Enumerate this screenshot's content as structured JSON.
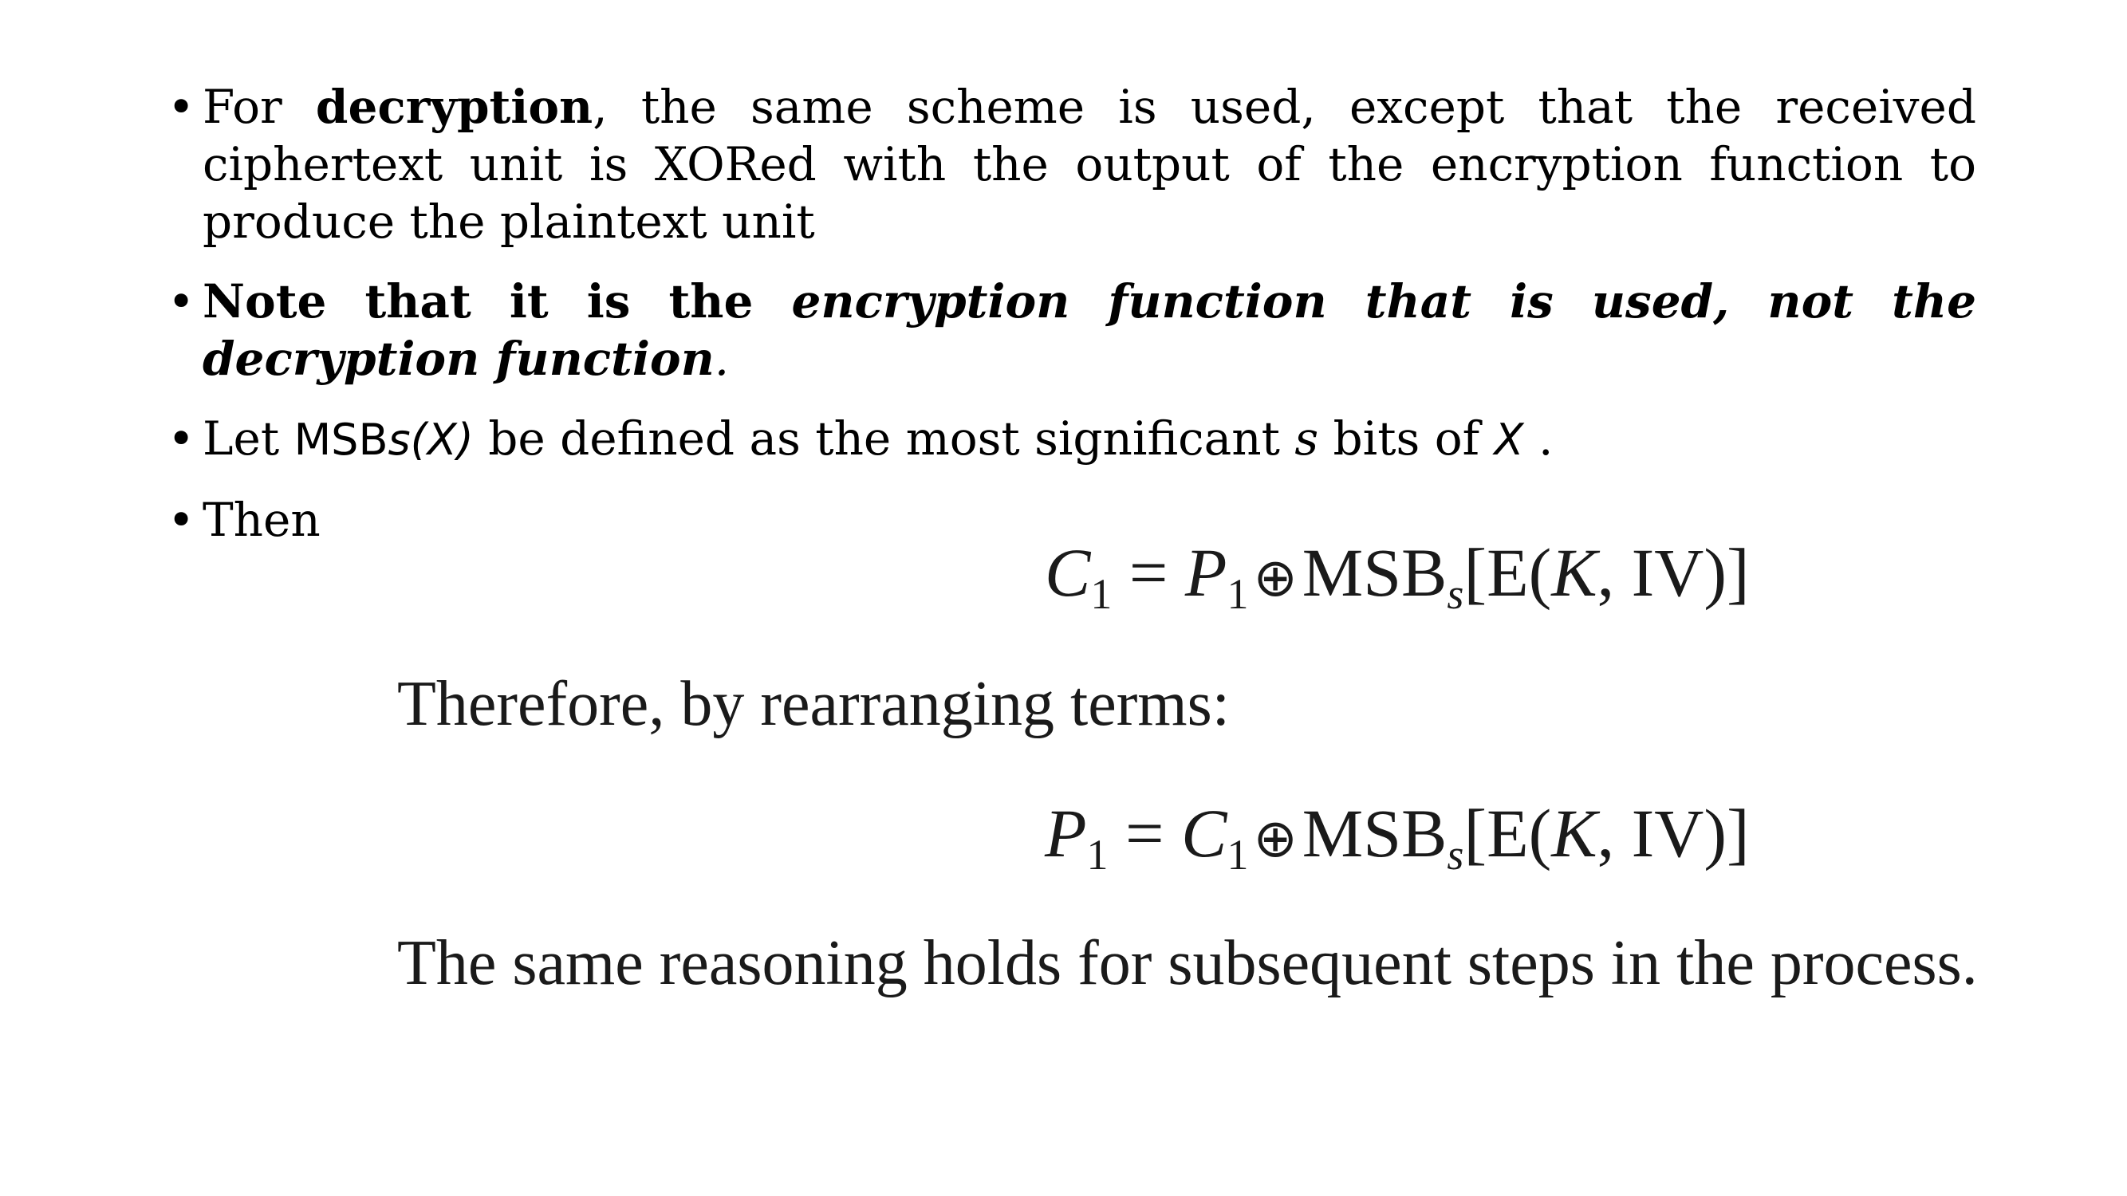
{
  "bullets": [
    {
      "prefix": "For ",
      "bold": "decryption",
      "rest": ", the same scheme is used, except that the received ciphertext unit is XORed with the output of the encryption function to produce the plaintext unit"
    },
    {
      "bold": "Note that it is the ",
      "bold_italic": "encryption function that is used, not the decryption function",
      "end": "."
    },
    {
      "prefix": "Let ",
      "msb": "MSB",
      "msb_arg": "s(X)",
      "mid": " be defined as the most significant ",
      "s": "s",
      "mid2": " bits of ",
      "x": "X",
      "end": " ."
    },
    {
      "text": "Then"
    }
  ],
  "bullet_symbol": "•",
  "equations": {
    "eq1": {
      "lhs": "C",
      "lhs_sub": "1",
      "eq": " = ",
      "var": "P",
      "var_sub": "1",
      "op": "⊕",
      "msb": "MSB",
      "msb_sub": "s",
      "arg_open": "[E(",
      "k": "K",
      "arg_close": ", IV)]"
    },
    "eq2": {
      "lhs": "P",
      "lhs_sub": "1",
      "eq": " = ",
      "var": "C",
      "var_sub": "1",
      "op": "⊕",
      "msb": "MSB",
      "msb_sub": "s",
      "arg_open": "[E(",
      "k": "K",
      "arg_close": ", IV)]"
    }
  },
  "prose": {
    "line1": "Therefore, by rearranging terms:",
    "line2": "The same reasoning holds for subsequent steps in the process."
  }
}
